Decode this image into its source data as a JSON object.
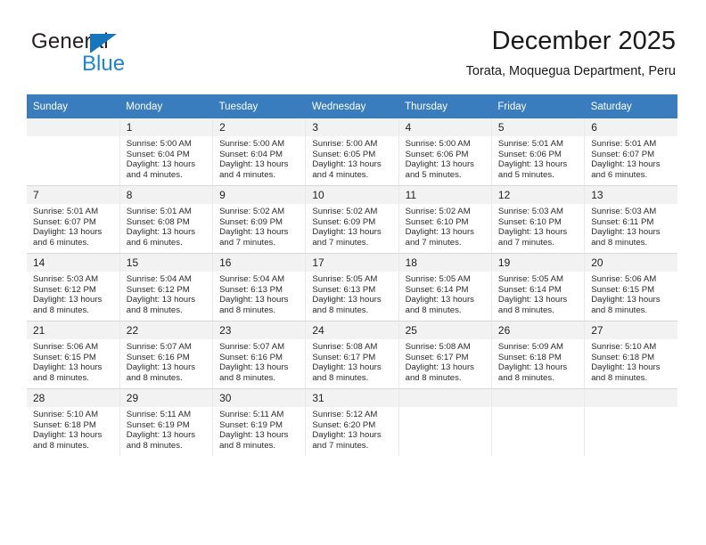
{
  "brand": {
    "name_part1": "General",
    "name_part2": "Blue"
  },
  "header": {
    "title": "December 2025",
    "subtitle": "Torata, Moquegua Department, Peru"
  },
  "calendar": {
    "weekday_headers": [
      "Sunday",
      "Monday",
      "Tuesday",
      "Wednesday",
      "Thursday",
      "Friday",
      "Saturday"
    ],
    "colors": {
      "header_bg": "#3a7dbf",
      "header_text": "#ffffff",
      "daynum_bg": "#f2f2f2",
      "brand_blue": "#1b87d2",
      "brand_triangle": "#1676bc"
    },
    "weeks": [
      [
        {
          "day": "",
          "sunrise": "",
          "sunset": "",
          "daylight_line1": "",
          "daylight_line2": "",
          "empty": true
        },
        {
          "day": "1",
          "sunrise": "Sunrise: 5:00 AM",
          "sunset": "Sunset: 6:04 PM",
          "daylight_line1": "Daylight: 13 hours",
          "daylight_line2": "and 4 minutes."
        },
        {
          "day": "2",
          "sunrise": "Sunrise: 5:00 AM",
          "sunset": "Sunset: 6:04 PM",
          "daylight_line1": "Daylight: 13 hours",
          "daylight_line2": "and 4 minutes."
        },
        {
          "day": "3",
          "sunrise": "Sunrise: 5:00 AM",
          "sunset": "Sunset: 6:05 PM",
          "daylight_line1": "Daylight: 13 hours",
          "daylight_line2": "and 4 minutes."
        },
        {
          "day": "4",
          "sunrise": "Sunrise: 5:00 AM",
          "sunset": "Sunset: 6:06 PM",
          "daylight_line1": "Daylight: 13 hours",
          "daylight_line2": "and 5 minutes."
        },
        {
          "day": "5",
          "sunrise": "Sunrise: 5:01 AM",
          "sunset": "Sunset: 6:06 PM",
          "daylight_line1": "Daylight: 13 hours",
          "daylight_line2": "and 5 minutes."
        },
        {
          "day": "6",
          "sunrise": "Sunrise: 5:01 AM",
          "sunset": "Sunset: 6:07 PM",
          "daylight_line1": "Daylight: 13 hours",
          "daylight_line2": "and 6 minutes."
        }
      ],
      [
        {
          "day": "7",
          "sunrise": "Sunrise: 5:01 AM",
          "sunset": "Sunset: 6:07 PM",
          "daylight_line1": "Daylight: 13 hours",
          "daylight_line2": "and 6 minutes."
        },
        {
          "day": "8",
          "sunrise": "Sunrise: 5:01 AM",
          "sunset": "Sunset: 6:08 PM",
          "daylight_line1": "Daylight: 13 hours",
          "daylight_line2": "and 6 minutes."
        },
        {
          "day": "9",
          "sunrise": "Sunrise: 5:02 AM",
          "sunset": "Sunset: 6:09 PM",
          "daylight_line1": "Daylight: 13 hours",
          "daylight_line2": "and 7 minutes."
        },
        {
          "day": "10",
          "sunrise": "Sunrise: 5:02 AM",
          "sunset": "Sunset: 6:09 PM",
          "daylight_line1": "Daylight: 13 hours",
          "daylight_line2": "and 7 minutes."
        },
        {
          "day": "11",
          "sunrise": "Sunrise: 5:02 AM",
          "sunset": "Sunset: 6:10 PM",
          "daylight_line1": "Daylight: 13 hours",
          "daylight_line2": "and 7 minutes."
        },
        {
          "day": "12",
          "sunrise": "Sunrise: 5:03 AM",
          "sunset": "Sunset: 6:10 PM",
          "daylight_line1": "Daylight: 13 hours",
          "daylight_line2": "and 7 minutes."
        },
        {
          "day": "13",
          "sunrise": "Sunrise: 5:03 AM",
          "sunset": "Sunset: 6:11 PM",
          "daylight_line1": "Daylight: 13 hours",
          "daylight_line2": "and 8 minutes."
        }
      ],
      [
        {
          "day": "14",
          "sunrise": "Sunrise: 5:03 AM",
          "sunset": "Sunset: 6:12 PM",
          "daylight_line1": "Daylight: 13 hours",
          "daylight_line2": "and 8 minutes."
        },
        {
          "day": "15",
          "sunrise": "Sunrise: 5:04 AM",
          "sunset": "Sunset: 6:12 PM",
          "daylight_line1": "Daylight: 13 hours",
          "daylight_line2": "and 8 minutes."
        },
        {
          "day": "16",
          "sunrise": "Sunrise: 5:04 AM",
          "sunset": "Sunset: 6:13 PM",
          "daylight_line1": "Daylight: 13 hours",
          "daylight_line2": "and 8 minutes."
        },
        {
          "day": "17",
          "sunrise": "Sunrise: 5:05 AM",
          "sunset": "Sunset: 6:13 PM",
          "daylight_line1": "Daylight: 13 hours",
          "daylight_line2": "and 8 minutes."
        },
        {
          "day": "18",
          "sunrise": "Sunrise: 5:05 AM",
          "sunset": "Sunset: 6:14 PM",
          "daylight_line1": "Daylight: 13 hours",
          "daylight_line2": "and 8 minutes."
        },
        {
          "day": "19",
          "sunrise": "Sunrise: 5:05 AM",
          "sunset": "Sunset: 6:14 PM",
          "daylight_line1": "Daylight: 13 hours",
          "daylight_line2": "and 8 minutes."
        },
        {
          "day": "20",
          "sunrise": "Sunrise: 5:06 AM",
          "sunset": "Sunset: 6:15 PM",
          "daylight_line1": "Daylight: 13 hours",
          "daylight_line2": "and 8 minutes."
        }
      ],
      [
        {
          "day": "21",
          "sunrise": "Sunrise: 5:06 AM",
          "sunset": "Sunset: 6:15 PM",
          "daylight_line1": "Daylight: 13 hours",
          "daylight_line2": "and 8 minutes."
        },
        {
          "day": "22",
          "sunrise": "Sunrise: 5:07 AM",
          "sunset": "Sunset: 6:16 PM",
          "daylight_line1": "Daylight: 13 hours",
          "daylight_line2": "and 8 minutes."
        },
        {
          "day": "23",
          "sunrise": "Sunrise: 5:07 AM",
          "sunset": "Sunset: 6:16 PM",
          "daylight_line1": "Daylight: 13 hours",
          "daylight_line2": "and 8 minutes."
        },
        {
          "day": "24",
          "sunrise": "Sunrise: 5:08 AM",
          "sunset": "Sunset: 6:17 PM",
          "daylight_line1": "Daylight: 13 hours",
          "daylight_line2": "and 8 minutes."
        },
        {
          "day": "25",
          "sunrise": "Sunrise: 5:08 AM",
          "sunset": "Sunset: 6:17 PM",
          "daylight_line1": "Daylight: 13 hours",
          "daylight_line2": "and 8 minutes."
        },
        {
          "day": "26",
          "sunrise": "Sunrise: 5:09 AM",
          "sunset": "Sunset: 6:18 PM",
          "daylight_line1": "Daylight: 13 hours",
          "daylight_line2": "and 8 minutes."
        },
        {
          "day": "27",
          "sunrise": "Sunrise: 5:10 AM",
          "sunset": "Sunset: 6:18 PM",
          "daylight_line1": "Daylight: 13 hours",
          "daylight_line2": "and 8 minutes."
        }
      ],
      [
        {
          "day": "28",
          "sunrise": "Sunrise: 5:10 AM",
          "sunset": "Sunset: 6:18 PM",
          "daylight_line1": "Daylight: 13 hours",
          "daylight_line2": "and 8 minutes."
        },
        {
          "day": "29",
          "sunrise": "Sunrise: 5:11 AM",
          "sunset": "Sunset: 6:19 PM",
          "daylight_line1": "Daylight: 13 hours",
          "daylight_line2": "and 8 minutes."
        },
        {
          "day": "30",
          "sunrise": "Sunrise: 5:11 AM",
          "sunset": "Sunset: 6:19 PM",
          "daylight_line1": "Daylight: 13 hours",
          "daylight_line2": "and 8 minutes."
        },
        {
          "day": "31",
          "sunrise": "Sunrise: 5:12 AM",
          "sunset": "Sunset: 6:20 PM",
          "daylight_line1": "Daylight: 13 hours",
          "daylight_line2": "and 7 minutes."
        },
        {
          "day": "",
          "sunrise": "",
          "sunset": "",
          "daylight_line1": "",
          "daylight_line2": "",
          "empty": true
        },
        {
          "day": "",
          "sunrise": "",
          "sunset": "",
          "daylight_line1": "",
          "daylight_line2": "",
          "empty": true
        },
        {
          "day": "",
          "sunrise": "",
          "sunset": "",
          "daylight_line1": "",
          "daylight_line2": "",
          "empty": true
        }
      ]
    ]
  }
}
